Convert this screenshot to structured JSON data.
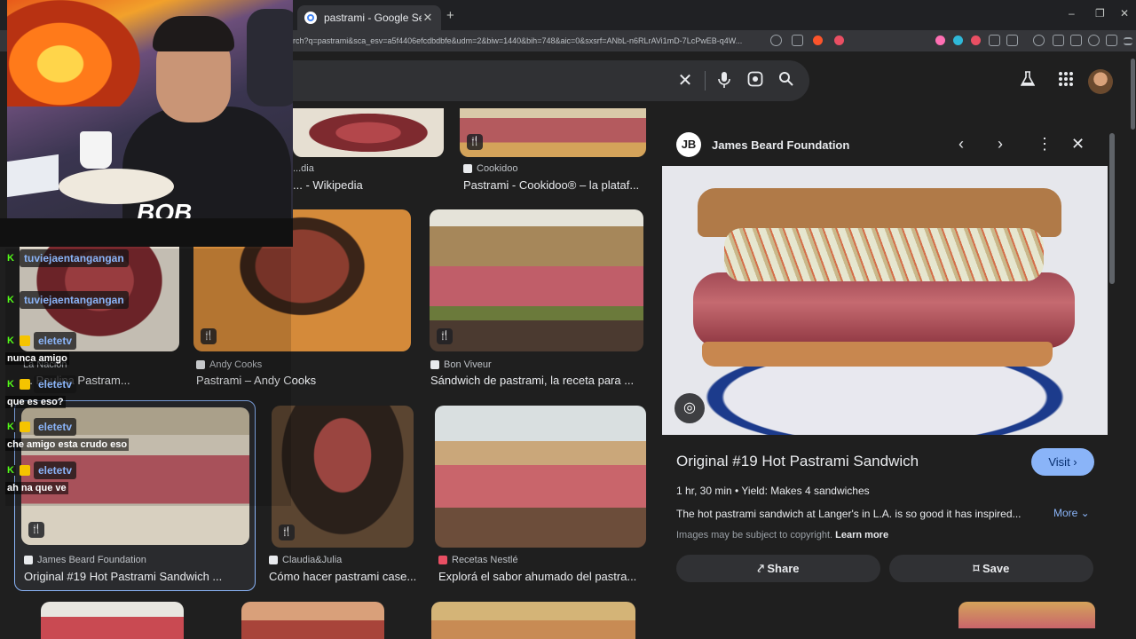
{
  "browser": {
    "tab_title": "pastrami - Google Search",
    "tab_close": "✕",
    "new_tab": "+",
    "url": "rch?q=pastrami&sca_esv=a5f4406efcdbdbfe&udm=2&biw=1440&bih=748&aic=0&sxsrf=ANbL-n6RLrAVi1mD-7LcPwEB-q4W...",
    "window_controls": [
      "–",
      "❐",
      "✕"
    ]
  },
  "search": {
    "icons": [
      "close-icon",
      "mic-icon",
      "lens-icon",
      "search-icon"
    ]
  },
  "results": [
    {
      "source": "...dia",
      "title": "... - Wikipedia",
      "color": "#ffffff"
    },
    {
      "source": "Cookidoo",
      "title": "Pastrami - Cookidoo® – la plataf..."
    },
    {
      "source": "La Nación",
      "title": "... Paulina Pastram..."
    },
    {
      "source": "Andy Cooks",
      "title": "Pastrami – Andy Cooks"
    },
    {
      "source": "Bon Viveur",
      "title": "Sándwich de pastrami, la receta para ..."
    },
    {
      "source": "James Beard Foundation",
      "title": "Original #19 Hot Pastrami Sandwich ..."
    },
    {
      "source": "Claudia&Julia",
      "title": "Cómo hacer pastrami case..."
    },
    {
      "source": "Recetas Nestlé",
      "title": "Explorá el sabor ahumado del pastra..."
    }
  ],
  "preview": {
    "site": "James Beard Foundation",
    "title": "Original #19 Hot Pastrami Sandwich",
    "visit_label": "Visit",
    "meta": "1 hr, 30 min  •  Yield: Makes 4 sandwiches",
    "description": "The hot pastrami sandwich at Langer's in L.A. is so good it has inspired...",
    "more_label": "More",
    "copyright": "Images may be subject to copyright.",
    "learn_more": "Learn more",
    "share_label": "Share",
    "save_label": "Save"
  },
  "stream": {
    "overlay_text": "BOB",
    "chat": [
      {
        "user": "tuviejaentangangan",
        "message": ""
      },
      {
        "user": "tuviejaentangangan",
        "message": ""
      },
      {
        "user": "eletetv",
        "message": "nunca amigo"
      },
      {
        "user": "eletetv",
        "message": "que es eso?"
      },
      {
        "user": "eletetv",
        "message": "che amigo esta crudo eso"
      },
      {
        "user": "eletetv",
        "message": "ah na que ve"
      }
    ]
  },
  "colors": {
    "accent": "#8ab4f8",
    "chat_badge": "#53fc18"
  }
}
